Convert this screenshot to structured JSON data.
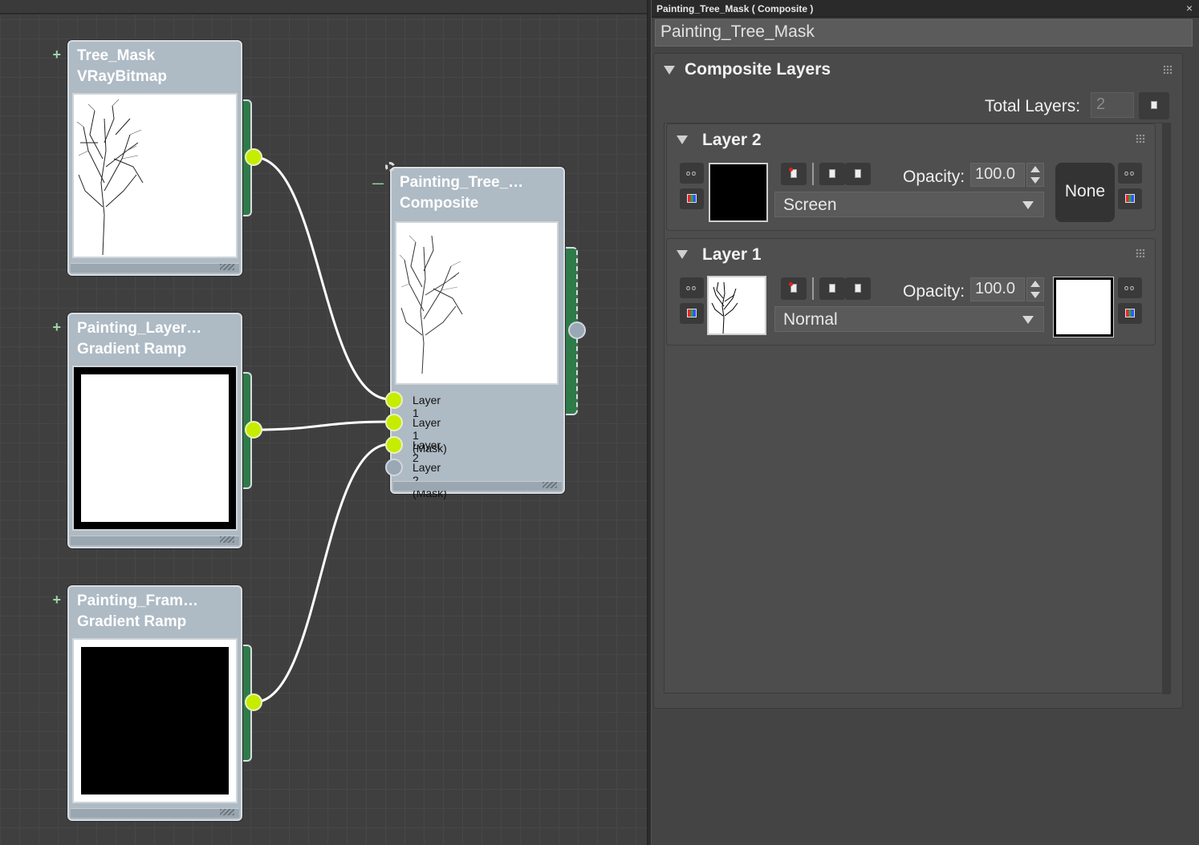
{
  "graph": {
    "nodes": {
      "tree_mask": {
        "title": "Tree_Mask",
        "type": "VRayBitmap"
      },
      "painting_layer": {
        "title": "Painting_Layer…",
        "type": "Gradient Ramp"
      },
      "painting_frame": {
        "title": "Painting_Fram…",
        "type": "Gradient Ramp"
      },
      "composite": {
        "title": "Painting_Tree_…",
        "type": "Composite",
        "slots": [
          "Layer 1",
          "Layer 1 (Mask)",
          "Layer 2",
          "Layer 2 (Mask)"
        ]
      }
    },
    "plus_symbol": "+",
    "minus_symbol": "—"
  },
  "panel": {
    "title": "Painting_Tree_Mask  ( Composite )",
    "close": "×",
    "name_field": "Painting_Tree_Mask",
    "rollout_title": "Composite Layers",
    "total_layers_label": "Total Layers:",
    "total_layers_value": "2",
    "opacity_label": "Opacity:",
    "layers": [
      {
        "title": "Layer 2",
        "opacity": "100.0",
        "blend_mode": "Screen",
        "mask_label": "None"
      },
      {
        "title": "Layer 1",
        "opacity": "100.0",
        "blend_mode": "Normal",
        "mask_label": ""
      }
    ]
  },
  "colors": {
    "node_header": "#2f7a49",
    "port_active": "#c6ec00",
    "port_inactive": "#9aa7b4",
    "wire": "#ffffff"
  }
}
